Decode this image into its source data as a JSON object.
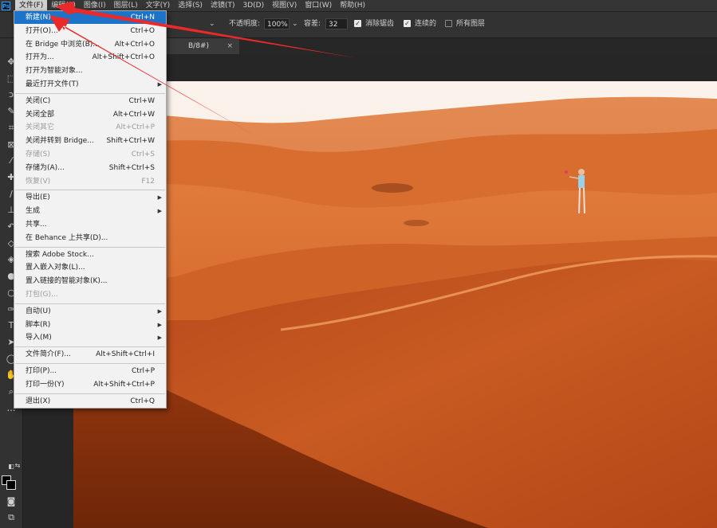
{
  "menubar": {
    "logo": "Ps",
    "items": [
      {
        "label": "文件(F)",
        "active": true
      },
      {
        "label": "编辑(E)"
      },
      {
        "label": "图像(I)"
      },
      {
        "label": "图层(L)"
      },
      {
        "label": "文字(Y)"
      },
      {
        "label": "选择(S)"
      },
      {
        "label": "滤镜(T)"
      },
      {
        "label": "3D(D)"
      },
      {
        "label": "视图(V)"
      },
      {
        "label": "窗口(W)"
      },
      {
        "label": "帮助(H)"
      }
    ]
  },
  "options": {
    "opacity_label": "不透明度:",
    "opacity_value": "100%",
    "tolerance_label": "容差:",
    "tolerance_value": "32",
    "antialias_label": "消除锯齿",
    "antialias_checked": true,
    "contiguous_label": "连续的",
    "contiguous_checked": true,
    "all_layers_label": "所有图层",
    "all_layers_checked": false
  },
  "document_tab": {
    "label": "B/8#)",
    "close": "×"
  },
  "file_menu": {
    "items": [
      {
        "label": "新建(N)...",
        "shortcut": "Ctrl+N",
        "highlighted": true
      },
      {
        "label": "打开(O)...",
        "shortcut": "Ctrl+O"
      },
      {
        "label": "在 Bridge 中浏览(B)...",
        "shortcut": "Alt+Ctrl+O"
      },
      {
        "label": "打开为...",
        "shortcut": "Alt+Shift+Ctrl+O"
      },
      {
        "label": "打开为智能对象..."
      },
      {
        "label": "最近打开文件(T)",
        "submenu": true
      },
      {
        "separator": true
      },
      {
        "label": "关闭(C)",
        "shortcut": "Ctrl+W"
      },
      {
        "label": "关闭全部",
        "shortcut": "Alt+Ctrl+W"
      },
      {
        "label": "关闭其它",
        "shortcut": "Alt+Ctrl+P",
        "disabled": true
      },
      {
        "label": "关闭并转到 Bridge...",
        "shortcut": "Shift+Ctrl+W"
      },
      {
        "label": "存储(S)",
        "shortcut": "Ctrl+S",
        "disabled": true
      },
      {
        "label": "存储为(A)...",
        "shortcut": "Shift+Ctrl+S"
      },
      {
        "label": "恢复(V)",
        "shortcut": "F12",
        "disabled": true
      },
      {
        "separator": true
      },
      {
        "label": "导出(E)",
        "submenu": true
      },
      {
        "label": "生成",
        "submenu": true
      },
      {
        "label": "共享..."
      },
      {
        "label": "在 Behance 上共享(D)..."
      },
      {
        "separator": true
      },
      {
        "label": "搜索 Adobe Stock..."
      },
      {
        "label": "置入嵌入对象(L)..."
      },
      {
        "label": "置入链接的智能对象(K)..."
      },
      {
        "label": "打包(G)...",
        "disabled": true
      },
      {
        "separator": true
      },
      {
        "label": "自动(U)",
        "submenu": true
      },
      {
        "label": "脚本(R)",
        "submenu": true
      },
      {
        "label": "导入(M)",
        "submenu": true
      },
      {
        "separator": true
      },
      {
        "label": "文件简介(F)...",
        "shortcut": "Alt+Shift+Ctrl+I"
      },
      {
        "separator": true
      },
      {
        "label": "打印(P)...",
        "shortcut": "Ctrl+P"
      },
      {
        "label": "打印一份(Y)",
        "shortcut": "Alt+Shift+Ctrl+P"
      },
      {
        "separator": true
      },
      {
        "label": "退出(X)",
        "shortcut": "Ctrl+Q"
      }
    ]
  },
  "tools": [
    {
      "icon": "move-icon",
      "glyph": "✥"
    },
    {
      "icon": "marquee-icon",
      "glyph": "⬚"
    },
    {
      "icon": "lasso-icon",
      "glyph": "ↄ"
    },
    {
      "icon": "quick-select-icon",
      "glyph": "✎"
    },
    {
      "icon": "crop-icon",
      "glyph": "⌗"
    },
    {
      "icon": "frame-icon",
      "glyph": "⊠"
    },
    {
      "icon": "eyedropper-icon",
      "glyph": "⁄"
    },
    {
      "icon": "healing-icon",
      "glyph": "✚"
    },
    {
      "icon": "brush-icon",
      "glyph": "∕"
    },
    {
      "icon": "stamp-icon",
      "glyph": "⊥"
    },
    {
      "icon": "history-brush-icon",
      "glyph": "↶"
    },
    {
      "icon": "eraser-icon",
      "glyph": "◇"
    },
    {
      "icon": "paint-bucket-icon",
      "glyph": "◈"
    },
    {
      "icon": "blur-icon",
      "glyph": "●"
    },
    {
      "icon": "dodge-icon",
      "glyph": "○"
    },
    {
      "icon": "pen-icon",
      "glyph": "✑"
    },
    {
      "icon": "type-icon",
      "glyph": "T"
    },
    {
      "icon": "path-select-icon",
      "glyph": "➤"
    },
    {
      "icon": "ellipse-icon",
      "glyph": "◯"
    },
    {
      "icon": "hand-icon",
      "glyph": "✋"
    },
    {
      "icon": "zoom-icon",
      "glyph": "⌕"
    },
    {
      "icon": "more-tools-icon",
      "glyph": "…"
    }
  ],
  "colors": {
    "accent": "#1d73c8",
    "arrow": "#ea2a2a",
    "foreground": "#000000",
    "background": "#000000"
  }
}
